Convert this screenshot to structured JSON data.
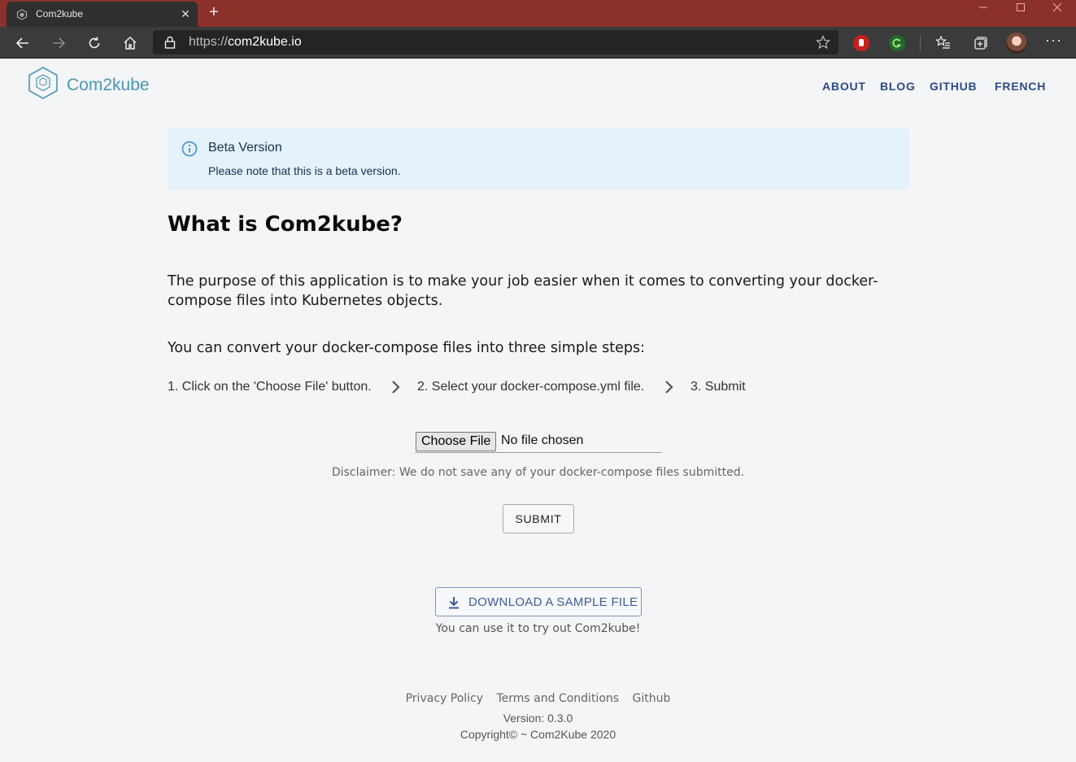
{
  "browser": {
    "tab_title": "Com2kube",
    "tab_close": "✕",
    "new_tab": "+",
    "url_scheme": "https://",
    "url_host": "com2kube.io",
    "more_menu": "···"
  },
  "header": {
    "logo_text": "Com2kube",
    "nav": [
      "ABOUT",
      "BLOG",
      "GITHUB",
      "FRENCH"
    ]
  },
  "alert": {
    "title": "Beta Version",
    "text": "Please note that this is a beta version."
  },
  "main": {
    "heading": "What is Com2kube?",
    "purpose": "The purpose of this application is to make your job easier when it comes to converting your docker-compose files into Kubernetes objects.",
    "steps_intro": "You can convert your docker-compose files into three simple steps:",
    "steps": [
      "1. Click on the 'Choose File' button.",
      "2. Select your docker-compose.yml file.",
      "3. Submit"
    ],
    "file_button": "Choose File",
    "file_status": "No file chosen",
    "disclaimer": "Disclaimer: We do not save any of your docker-compose files submitted.",
    "submit_label": "SUBMIT",
    "download_label": "DOWNLOAD A SAMPLE FILE",
    "download_hint": "You can use it to try out Com2kube!"
  },
  "footer": {
    "links": [
      "Privacy Policy",
      "Terms and Conditions",
      "Github"
    ],
    "version": "Version: 0.3.0",
    "copyright": "Copyright© ~ Com2Kube 2020"
  },
  "colors": {
    "titlebar": "#8b3129",
    "nav": "#2c4a86",
    "logo": "#4a97b4",
    "alert_bg": "#e5f2fb"
  }
}
